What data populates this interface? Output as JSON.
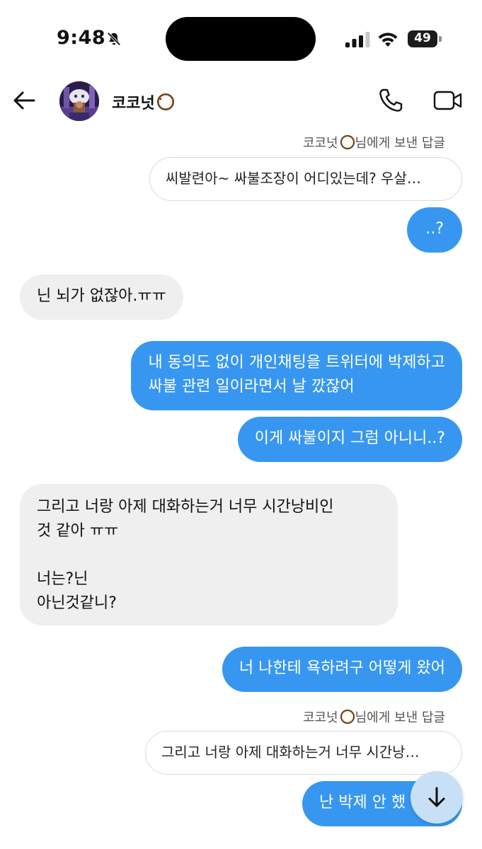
{
  "status_bar": {
    "time": "9:48",
    "battery": "49"
  },
  "header": {
    "contact_name": "코코넛",
    "contact_emoji": "coconut-emoji",
    "call_icon": "phone-icon",
    "video_icon": "video-camera-icon"
  },
  "messages": {
    "reply1": {
      "label_prefix": "코코넛",
      "label_suffix": "님에게 보낸 답글",
      "quote": "씨발련아~ 싸불조장이 어디있는데? 우살…"
    },
    "m1": "..?",
    "m2": "닌 뇌가 없잖아.ㅠㅠ",
    "m3": "내 동의도 없이 개인채팅을 트위터에 박제하고\n싸불 관련 일이라면서 날 깠잖어",
    "m4": "이게 싸불이지 그럼 아니니..?",
    "m5": "그리고 너랑 아제 대화하는거 너무 시간낭비인\n것 같아 ㅠㅠ\n\n너는?닌\n아닌것같니?",
    "m6": "너 나한테 욕하려구 어떻게 왔어",
    "reply2": {
      "label_prefix": "코코넛",
      "label_suffix": "님에게 보낸 답글",
      "quote": "그리고 너랑 아제 대화하는거 너무 시간낭…"
    },
    "m7": "난 박제 안 했"
  },
  "colors": {
    "outgoing": "#3797f0",
    "incoming": "#efefef"
  }
}
